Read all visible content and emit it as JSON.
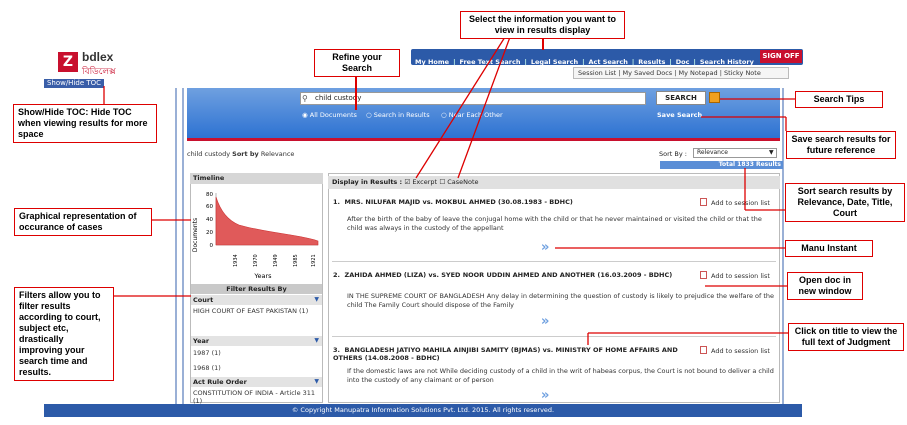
{
  "logo": {
    "mark": "Z",
    "name": "bdlex",
    "bangla": "বিডিলেক্স"
  },
  "toc_button": "Show/Hide TOC",
  "nav": {
    "items": [
      "My Home",
      "Free Text Search",
      "Legal Search",
      "Act Search",
      "Results",
      "Doc",
      "Search History"
    ],
    "signoff": "SIGN OFF",
    "sub_items": "Session List  |  My Saved Docs  |  My Notepad  |  Sticky Note"
  },
  "search": {
    "query": "child custody",
    "button": "SEARCH",
    "options": [
      "All Documents",
      "Search in Results",
      "Near Each Other"
    ],
    "save_label": "Save Search"
  },
  "sort": {
    "query_label": "child custody",
    "sorted_by_prefix": "Sort by",
    "sorted_by_value": "Relevance",
    "label": "Sort By :",
    "selected": "Relevance",
    "total": "Total 1833 Results"
  },
  "timeline": {
    "title": "Timeline",
    "y_label": "Documents",
    "x_label": "Years",
    "y_ticks": [
      "80",
      "60",
      "40",
      "20",
      "0"
    ],
    "x_ticks": [
      "1934",
      "1970",
      "1949",
      "1985",
      "1921"
    ]
  },
  "filters": {
    "title": "Filter Results By",
    "groups": [
      {
        "name": "Court",
        "items": [
          "HIGH COURT OF EAST PAKISTAN (1)"
        ]
      },
      {
        "name": "Year",
        "items": [
          "1987 (1)",
          "1968 (1)"
        ]
      },
      {
        "name": "Act Rule Order",
        "items": [
          "CONSTITUTION OF INDIA - Article 311 (1)"
        ]
      }
    ]
  },
  "results_head": {
    "label": "Display in Results :",
    "opt1": "Excerpt",
    "opt2": "CaseNote"
  },
  "results": [
    {
      "num": "1.",
      "title": "MRS. NILUFAR MAJID vs. MOKBUL AHMED (30.08.1983 - BDHC)",
      "text": "After the birth of the baby of leave the conjugal home with the child or that he never maintained or visited the child or that the child was always in the custody of the appellant"
    },
    {
      "num": "2.",
      "title": "ZAHIDA AHMED (LIZA) vs. SYED NOOR UDDIN AHMED AND ANOTHER (16.03.2009 - BDHC)",
      "text": "IN THE SUPREME COURT OF BANGLADESH Any delay in determining the question of custody is likely to prejudice the welfare of the child The Family Court should dispose of the Family"
    },
    {
      "num": "3.",
      "title": "BANGLADESH JATIYO MAHILA AINJIBI SAMITY (BJMAS) vs. MINISTRY OF HOME AFFAIRS AND OTHERS (14.08.2008 - BDHC)",
      "text": "If the domestic laws are not While deciding custody of a child in the writ of habeas corpus, the Court is not bound to deliver a child into the custody of any claimant or of person"
    }
  ],
  "add_session": "Add to session list",
  "more_glyph": "»",
  "footer": "© Copyright Manupatra Information Solutions Pvt. Ltd. 2015. All rights reserved.",
  "callouts": {
    "select_info": "Select the information you want to view in results display",
    "refine": "Refine your Search",
    "show_hide": "Show/Hide TOC: Hide TOC when viewing results for more space",
    "search_tips": "Search Tips",
    "save_results": "Save search results for future reference",
    "sort_results": "Sort search results by Relevance, Date, Title, Court",
    "graphical": "Graphical representation of occurance of cases",
    "manu_instant": "Manu Instant",
    "open_doc": "Open doc in new window",
    "filters": "Filters allow you to filter results according to court, subject etc, drastically improving your search time and results.",
    "click_title": "Click on title to view the full text of Judgment"
  }
}
